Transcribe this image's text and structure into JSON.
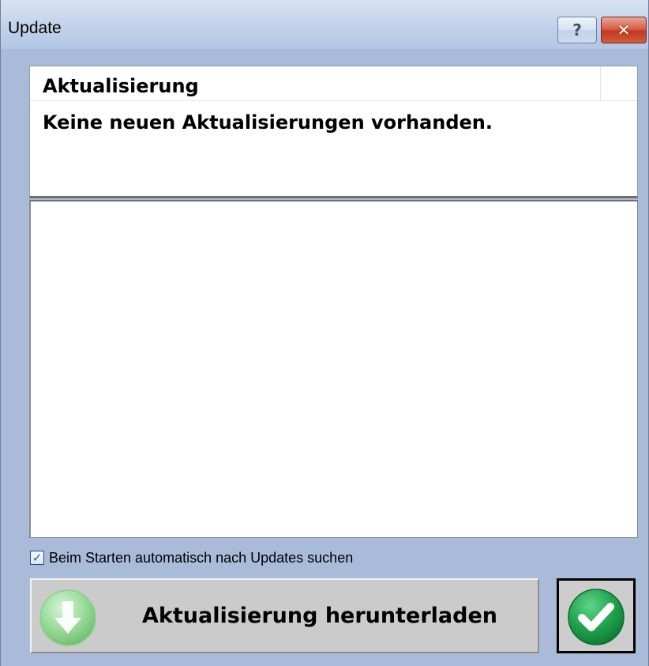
{
  "window": {
    "title": "Update",
    "help_glyph": "?",
    "close_glyph": "✕"
  },
  "info": {
    "title": "Aktualisierung",
    "message": "Keine neuen Aktualisierungen vorhanden."
  },
  "auto_check": {
    "label": "Beim Starten automatisch nach Updates suchen",
    "checked": true,
    "check_glyph": "✓"
  },
  "download_button": {
    "label": "Aktualisierung herunterladen",
    "icon": "download-arrow-icon"
  },
  "ok_button": {
    "icon": "checkmark-icon"
  },
  "colors": {
    "window_bg": "#a9bbd9",
    "close_button": "#c03a20",
    "download_icon": "#7fce7f",
    "ok_icon": "#1a9a45"
  }
}
